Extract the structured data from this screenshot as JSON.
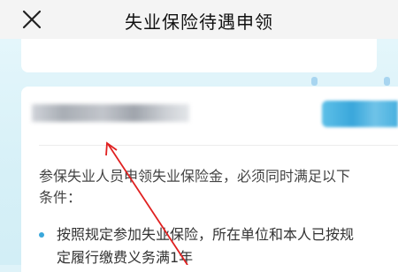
{
  "header": {
    "title": "失业保险待遇申领",
    "close_icon": "close-icon"
  },
  "content": {
    "intro_line1": "参保失业人员申领失业保险金，必须同时满足以下",
    "intro_line2": "条件：",
    "items": [
      {
        "line1": "按照规定参加失业保险，所在单位和本人已按规",
        "line2": "定履行缴费义务满1年"
      }
    ]
  },
  "colors": {
    "accent": "#3aa7db",
    "annotation_arrow": "#e02020"
  }
}
